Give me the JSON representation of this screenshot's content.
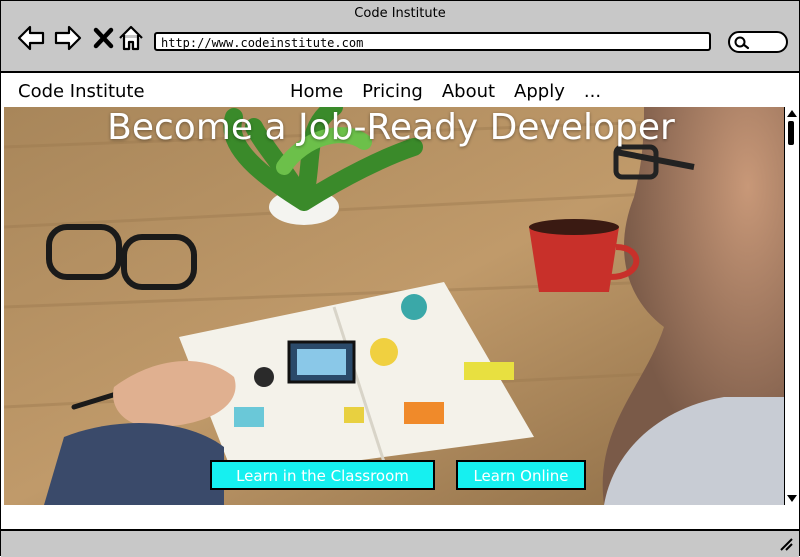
{
  "window": {
    "title": "Code Institute",
    "address": "http://www.codeinstitute.com"
  },
  "toolbar_icons": [
    "back-arrow-icon",
    "forward-arrow-icon",
    "close-x-icon",
    "home-icon",
    "search-icon"
  ],
  "navbar": {
    "brand": "Code Institute",
    "items": [
      {
        "label": "Home"
      },
      {
        "label": "Pricing"
      },
      {
        "label": "About"
      },
      {
        "label": "Apply"
      },
      {
        "label": "..."
      }
    ]
  },
  "hero": {
    "headline": "Become a Job-Ready Developer",
    "buttons": {
      "classroom": "Learn in the Classroom",
      "online": "Learn Online"
    }
  },
  "colors": {
    "button_bg": "#16f0f0",
    "chrome_gray": "#c8c8c8"
  }
}
